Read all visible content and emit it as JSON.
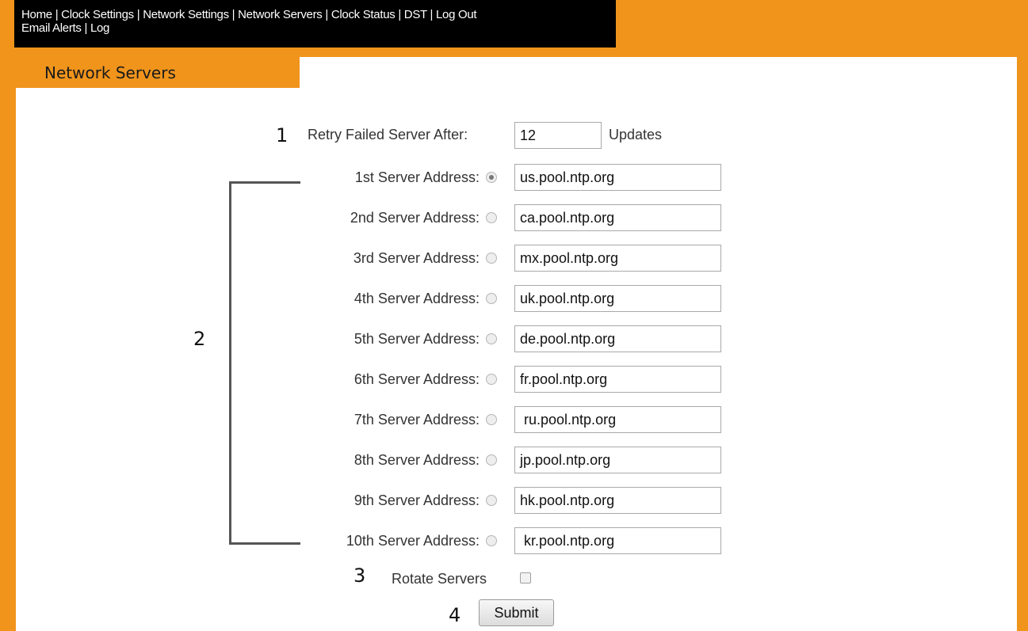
{
  "nav": {
    "items": [
      "Home",
      "Clock Settings",
      "Network Settings",
      "Network Servers",
      "Clock Status",
      "DST",
      "Log Out",
      "Email Alerts",
      "Log"
    ]
  },
  "page_title": "Network Servers",
  "retry": {
    "label": "Retry Failed Server After:",
    "value": "12",
    "unit": "Updates"
  },
  "servers": [
    {
      "label": "1st Server Address:",
      "value": "us.pool.ntp.org",
      "selected": true
    },
    {
      "label": "2nd Server Address:",
      "value": "ca.pool.ntp.org",
      "selected": false
    },
    {
      "label": "3rd Server Address:",
      "value": "mx.pool.ntp.org",
      "selected": false
    },
    {
      "label": "4th Server Address:",
      "value": "uk.pool.ntp.org",
      "selected": false
    },
    {
      "label": "5th Server Address:",
      "value": "de.pool.ntp.org",
      "selected": false
    },
    {
      "label": "6th Server Address:",
      "value": "fr.pool.ntp.org",
      "selected": false
    },
    {
      "label": "7th Server Address:",
      "value": " ru.pool.ntp.org",
      "selected": false
    },
    {
      "label": "8th Server Address:",
      "value": "jp.pool.ntp.org",
      "selected": false
    },
    {
      "label": "9th Server Address:",
      "value": "hk.pool.ntp.org",
      "selected": false
    },
    {
      "label": "10th Server Address:",
      "value": " kr.pool.ntp.org",
      "selected": false
    }
  ],
  "rotate": {
    "label": "Rotate Servers",
    "checked": false
  },
  "submit_label": "Submit",
  "callouts": [
    "1",
    "2",
    "3",
    "4"
  ],
  "colors": {
    "background": "#f0941c",
    "nav_bg": "#000000",
    "panel": "#ffffff"
  }
}
